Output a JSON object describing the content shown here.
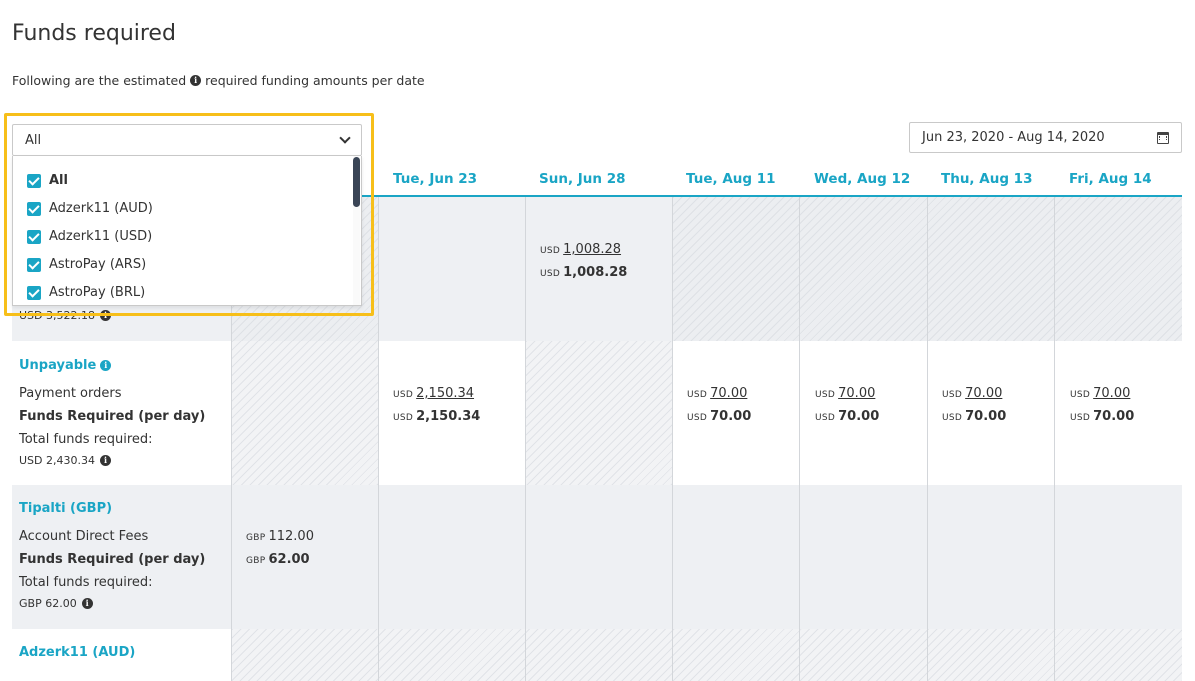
{
  "page": {
    "title": "Funds required",
    "subtitle_before": "Following are the estimated",
    "subtitle_after": "required funding amounts per date"
  },
  "filter": {
    "selected": "All",
    "options": [
      {
        "label": "All",
        "checked": true,
        "bold": true
      },
      {
        "label": "Adzerk11 (AUD)",
        "checked": true
      },
      {
        "label": "Adzerk11 (USD)",
        "checked": true
      },
      {
        "label": "AstroPay (ARS)",
        "checked": true
      },
      {
        "label": "AstroPay (BRL)",
        "checked": true
      }
    ]
  },
  "date_range": {
    "value": "Jun 23, 2020 - Aug 14, 2020",
    "icon": "calendar-icon"
  },
  "columns": [
    "Tue, Jun 23",
    "Sun, Jun 28",
    "Tue, Aug 11",
    "Wed, Aug 12",
    "Thu, Aug 13",
    "Fri, Aug 14"
  ],
  "sections": {
    "first": {
      "total_partial": "USD 3,522.18",
      "sun_jun28": {
        "currency": "USD",
        "payment": "1,008.28",
        "required": "1,008.28"
      }
    },
    "unpayable": {
      "title": "Unpayable",
      "label_payment_orders": "Payment orders",
      "label_funds_required": "Funds Required (per day)",
      "label_total": "Total funds required:",
      "total": "USD 2,430.34",
      "currency": "USD",
      "tue_jun23": {
        "payment": "2,150.34",
        "required": "2,150.34"
      },
      "tue_aug11": {
        "payment": "70.00",
        "required": "70.00"
      },
      "wed_aug12": {
        "payment": "70.00",
        "required": "70.00"
      },
      "thu_aug13": {
        "payment": "70.00",
        "required": "70.00"
      },
      "fri_aug14": {
        "payment": "70.00",
        "required": "70.00"
      }
    },
    "tipalti": {
      "title": "Tipalti (GBP)",
      "label_fees": "Account Direct Fees",
      "label_funds_required": "Funds Required (per day)",
      "label_total": "Total funds required:",
      "total": "GBP 62.00",
      "currency": "GBP",
      "first_col": {
        "fees": "112.00",
        "required": "62.00"
      }
    },
    "adzerk_aud": {
      "title": "Adzerk11 (AUD)"
    }
  },
  "colors": {
    "accent": "#1aa5c5",
    "highlight": "#f7bf19"
  }
}
